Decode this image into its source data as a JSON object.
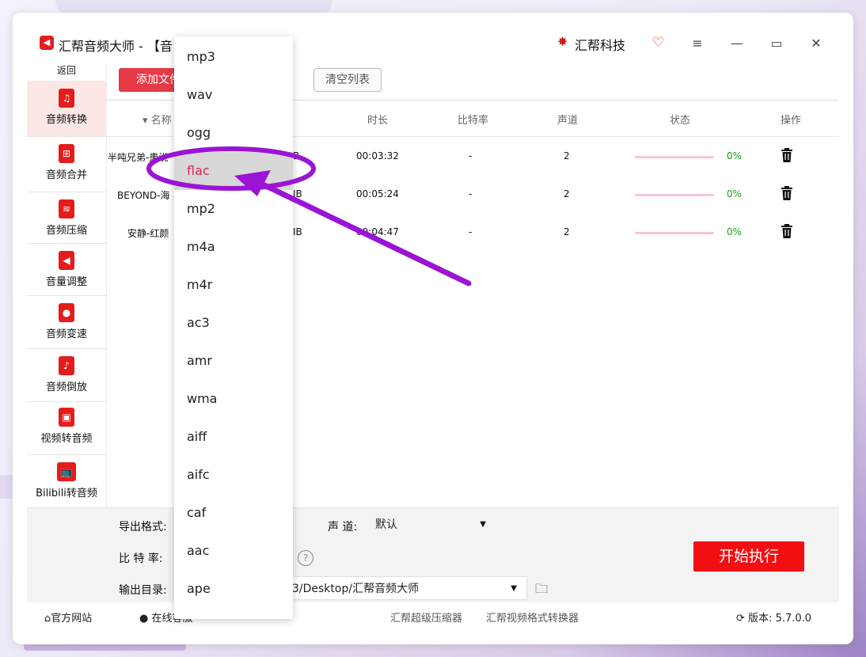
{
  "window": {
    "title": "汇帮音频大师  - 【音",
    "brand": "汇帮科技"
  },
  "sidebar": {
    "back_label": "返回",
    "items": [
      {
        "label": "音频转换",
        "icon": "audio-convert-icon"
      },
      {
        "label": "音频合并",
        "icon": "audio-merge-icon"
      },
      {
        "label": "音频压缩",
        "icon": "audio-compress-icon"
      },
      {
        "label": "音量调整",
        "icon": "volume-adjust-icon"
      },
      {
        "label": "音频变速",
        "icon": "audio-speed-icon"
      },
      {
        "label": "音频倒放",
        "icon": "audio-reverse-icon"
      },
      {
        "label": "视频转音频",
        "icon": "video-to-audio-icon"
      },
      {
        "label": "Bilibili转音频",
        "icon": "bilibili-icon"
      }
    ]
  },
  "toolbar": {
    "add_file_label": "添加文件",
    "clear_list_label": "清空列表"
  },
  "table": {
    "headers": {
      "name": "名称",
      "duration": "时长",
      "bitrate": "比特率",
      "channels": "声道",
      "status": "状态",
      "action": "操作"
    },
    "rows": [
      {
        "name": "半吨兄弟-患说",
        "size": "B",
        "duration": "00:03:32",
        "bitrate": "-",
        "channels": "2",
        "progress": 0,
        "progress_label": "0%"
      },
      {
        "name": "BEYOND-海",
        "size": "IB",
        "duration": "00:05:24",
        "bitrate": "-",
        "channels": "2",
        "progress": 0,
        "progress_label": "0%"
      },
      {
        "name": "安静-红颜",
        "size": "IB",
        "duration": "00:04:47",
        "bitrate": "-",
        "channels": "2",
        "progress": 0,
        "progress_label": "0%"
      }
    ]
  },
  "settings": {
    "export_format_label": "导出格式:",
    "channel_label": "声 道:",
    "channel_value": "默认",
    "bitrate_label": "比 特 率:",
    "help_glyph": "?",
    "output_dir_label": "输出目录:",
    "output_dir_value": "3/Desktop/汇帮音频大师",
    "start_label": "开始执行"
  },
  "dropdown": {
    "options": [
      "mp3",
      "wav",
      "ogg",
      "flac",
      "mp2",
      "m4a",
      "m4r",
      "ac3",
      "amr",
      "wma",
      "aiff",
      "aifc",
      "caf",
      "aac",
      "ape"
    ],
    "selected": "flac"
  },
  "footer": {
    "official_site": "官方网站",
    "online_service": "在线客服",
    "link1": "汇帮超级压缩器",
    "link2": "汇帮视频格式转换器",
    "version_label": "版本:",
    "version_value": "5.7.0.0"
  },
  "colors": {
    "accent_red": "#e51c1c",
    "start_button": "#f20f12",
    "progress_track": "#f6c6d4",
    "percent_text": "#19a019",
    "annotation_purple": "#9b14d6",
    "selected_option_text": "#e0245a"
  }
}
